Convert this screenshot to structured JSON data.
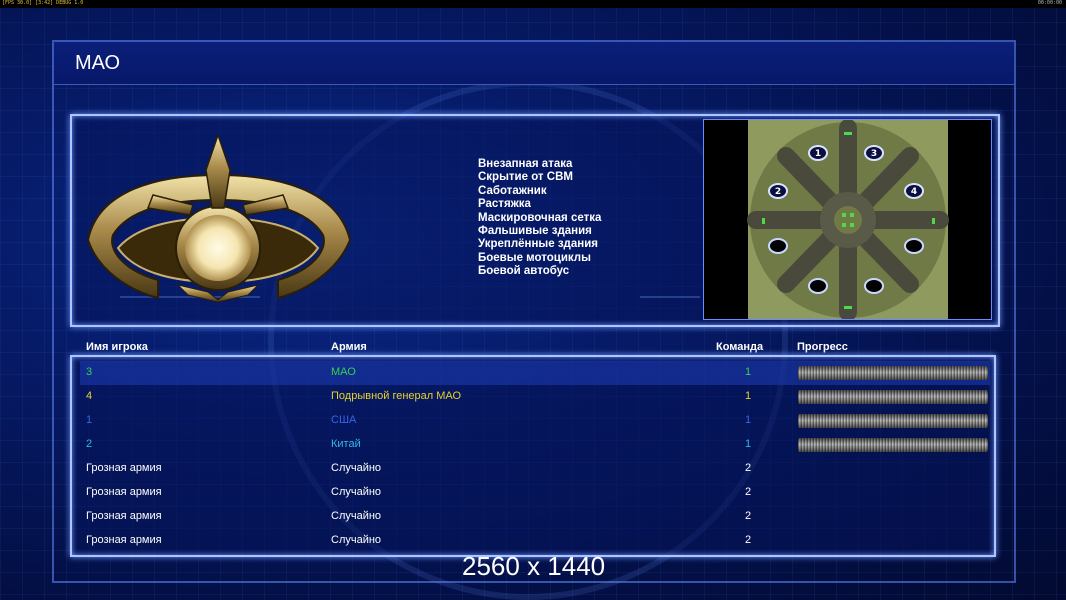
{
  "debug_left": "[FPS 30.0] [3:42] DEBUG 1.0",
  "debug_right": "00:00:00",
  "title": "МАО",
  "abilities": [
    "Внезапная атака",
    "Скрытие от СВМ",
    "Саботажник",
    "Растяжка",
    "Маскировочная сетка",
    "Фальшивые здания",
    "Укреплённые здания",
    "Боевые мотоциклы",
    "Боевой автобус"
  ],
  "map_slots": [
    "1",
    "3",
    "2",
    "4"
  ],
  "columns": {
    "name": "Имя игрока",
    "army": "Армия",
    "team": "Команда",
    "progress": "Прогресс"
  },
  "players": [
    {
      "name": "3",
      "army": "МАО",
      "team": "1",
      "color": "#35d24a",
      "progress": 1.0
    },
    {
      "name": "4",
      "army": "Подрывной генерал МАО",
      "team": "1",
      "color": "#e6d22a",
      "progress": 1.0
    },
    {
      "name": "1",
      "army": "США",
      "team": "1",
      "color": "#3a63e6",
      "progress": 1.0
    },
    {
      "name": "2",
      "army": "Китай",
      "team": "1",
      "color": "#33b6e8",
      "progress": 1.0
    },
    {
      "name": "Грозная армия",
      "army": "Случайно",
      "team": "2",
      "color": "#ffffff"
    },
    {
      "name": "Грозная армия",
      "army": "Случайно",
      "team": "2",
      "color": "#ffffff"
    },
    {
      "name": "Грозная армия",
      "army": "Случайно",
      "team": "2",
      "color": "#ffffff"
    },
    {
      "name": "Грозная армия",
      "army": "Случайно",
      "team": "2",
      "color": "#ffffff"
    }
  ],
  "resolution_label": "2560 x 1440",
  "colors": {
    "accent": "#aec6ff",
    "background": "#061a66"
  }
}
